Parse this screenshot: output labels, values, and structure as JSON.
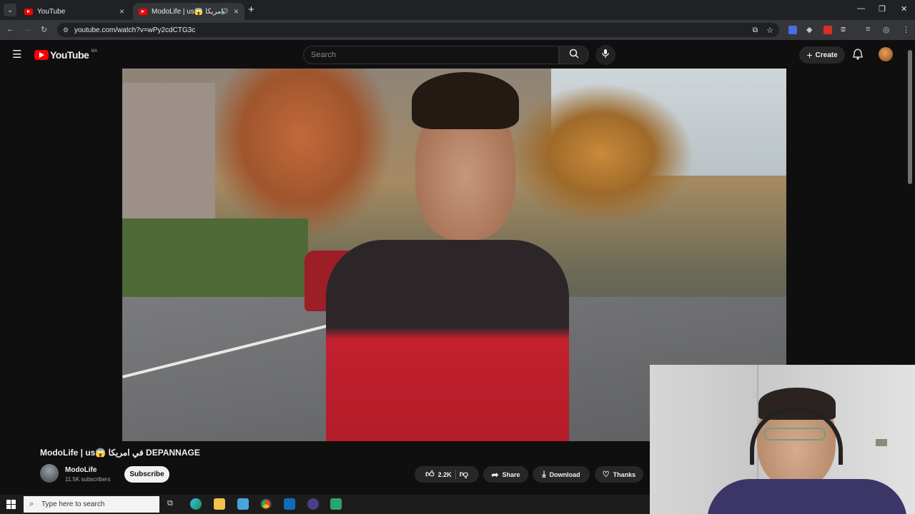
{
  "browser": {
    "tabs": [
      {
        "title": "YouTube"
      },
      {
        "title": "ModoLife | us😱 في امريكا"
      }
    ],
    "url": "youtube.com/watch?v=wPy2cdCTG3c"
  },
  "youtube": {
    "logo_text": "YouTube",
    "region_badge": "MA",
    "search_placeholder": "Search",
    "create_label": "Create"
  },
  "video": {
    "title": "ModoLife | us😱 في امريكا DEPANNAGE",
    "channel_name": "ModoLife",
    "subscribers": "11.5K subscribers",
    "subscribe_label": "Subscribe",
    "likes": "2.2K",
    "share_label": "Share",
    "download_label": "Download",
    "thanks_label": "Thanks"
  },
  "taskbar": {
    "search_placeholder": "Type here to search"
  },
  "colors": {
    "page_bg": "#0f0f0f",
    "youtube_red": "#ff0000",
    "pill_bg": "#272727",
    "subscribe_bg": "#f1f1f1"
  }
}
